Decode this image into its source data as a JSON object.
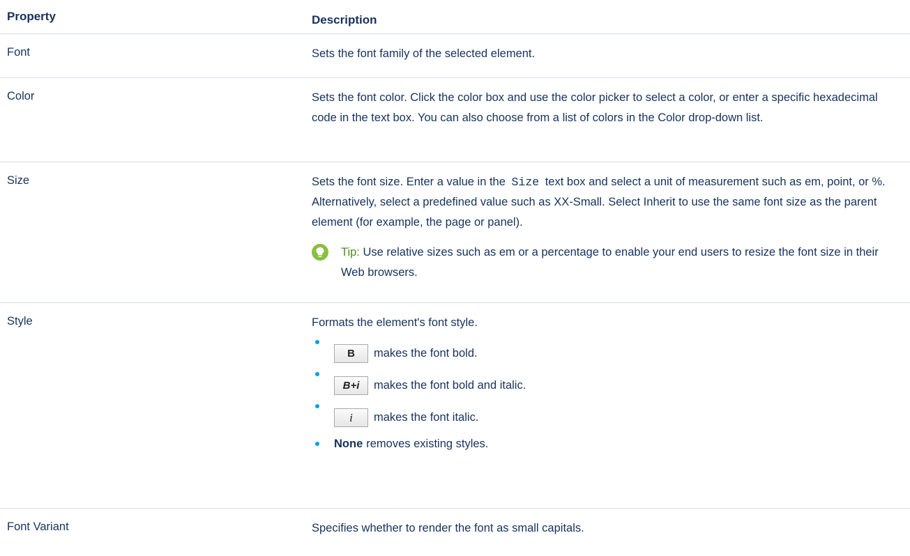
{
  "header": {
    "property": "Property",
    "description": "Description"
  },
  "rows": {
    "font": {
      "property": "Font",
      "description": "Sets the font family of the selected element."
    },
    "color": {
      "property": "Color",
      "description": "Sets the font color. Click the color box and use the color picker to select a color, or enter a specific hexadecimal code in the text box. You can also choose from a list of colors in the Color drop-down list."
    },
    "size": {
      "property": "Size",
      "description_before": "Sets the font size. Enter a value in the",
      "code": "Size",
      "description_after": "text box and select a unit of measurement such as em, point, or %. Alternatively, select a predefined value such as XX-Small. Select Inherit to use the same font size as the parent element (for example, the page or panel).",
      "tip_label": "Tip:",
      "tip_text": "Use relative sizes such as em or a percentage to enable your end users to resize the font size in their Web browsers."
    },
    "style": {
      "property": "Style",
      "intro": "Formats the element's font style.",
      "items": [
        {
          "button": "B",
          "text": "makes the font bold."
        },
        {
          "button": "B+i",
          "text": "makes the font bold and italic."
        },
        {
          "button": "i",
          "text": "makes the font italic."
        }
      ],
      "none_bold": "None",
      "none_text": "removes existing styles."
    },
    "font_variant": {
      "property": "Font Variant",
      "description": "Specifies whether to render the font as small capitals."
    }
  },
  "colors": {
    "text": "#16325c",
    "divider": "#d8dde6",
    "tip_green": "#4a8c1c",
    "tip_icon_bg": "#8bbf3f",
    "bullet": "#00a1e0"
  },
  "icons": {
    "tip": "lightbulb-icon"
  }
}
